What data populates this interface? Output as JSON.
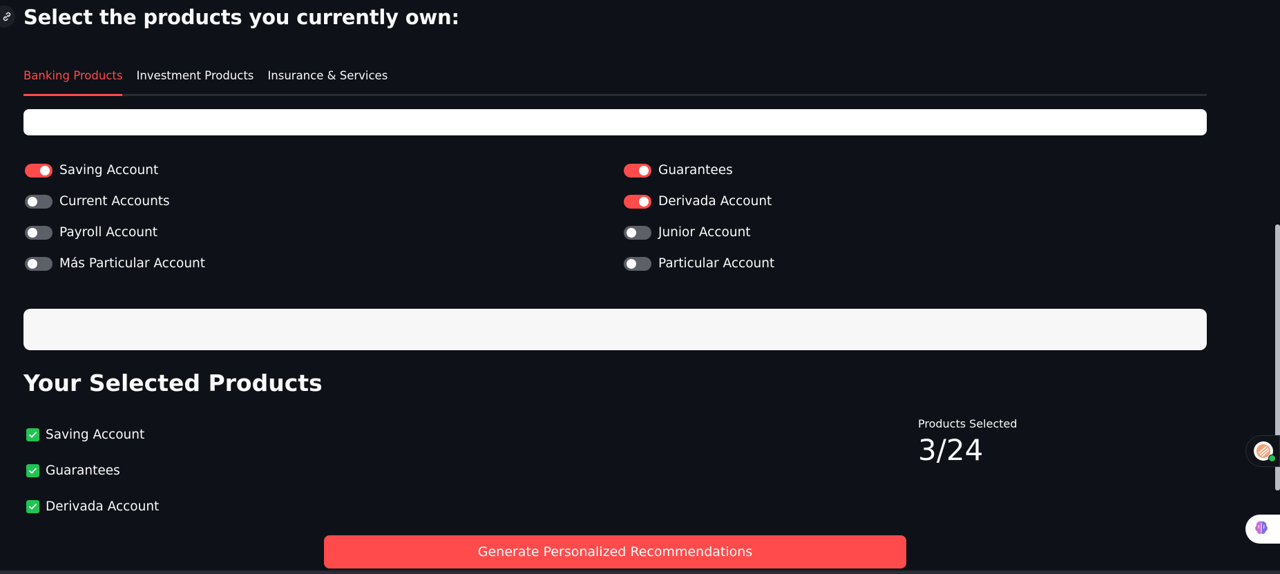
{
  "page_title": "Select the products you currently own:",
  "tabs": [
    {
      "label": "Banking Products",
      "active": true
    },
    {
      "label": "Investment Products",
      "active": false
    },
    {
      "label": "Insurance & Services",
      "active": false
    }
  ],
  "toggles_left": [
    {
      "label": "Saving Account",
      "on": true
    },
    {
      "label": "Current Accounts",
      "on": false
    },
    {
      "label": "Payroll Account",
      "on": false
    },
    {
      "label": "Más Particular Account",
      "on": false
    }
  ],
  "toggles_right": [
    {
      "label": "Guarantees",
      "on": true
    },
    {
      "label": "Derivada Account",
      "on": true
    },
    {
      "label": "Junior Account",
      "on": false
    },
    {
      "label": "Particular Account",
      "on": false
    }
  ],
  "selected_section": {
    "title": "Your Selected Products",
    "items": [
      "Saving Account",
      "Guarantees",
      "Derivada Account"
    ]
  },
  "metric": {
    "label": "Products Selected",
    "value": "3/24"
  },
  "primary_button": {
    "label": "Generate Personalized Recommendations"
  },
  "colors": {
    "background": "#0e1117",
    "accent": "#ff4b4b",
    "check": "#21c354",
    "toggle_off": "#5d6068"
  },
  "icons": {
    "corner": "link-icon",
    "check": "check-icon",
    "float_one": "assistant-avatar-icon",
    "float_two": "brain-icon"
  }
}
